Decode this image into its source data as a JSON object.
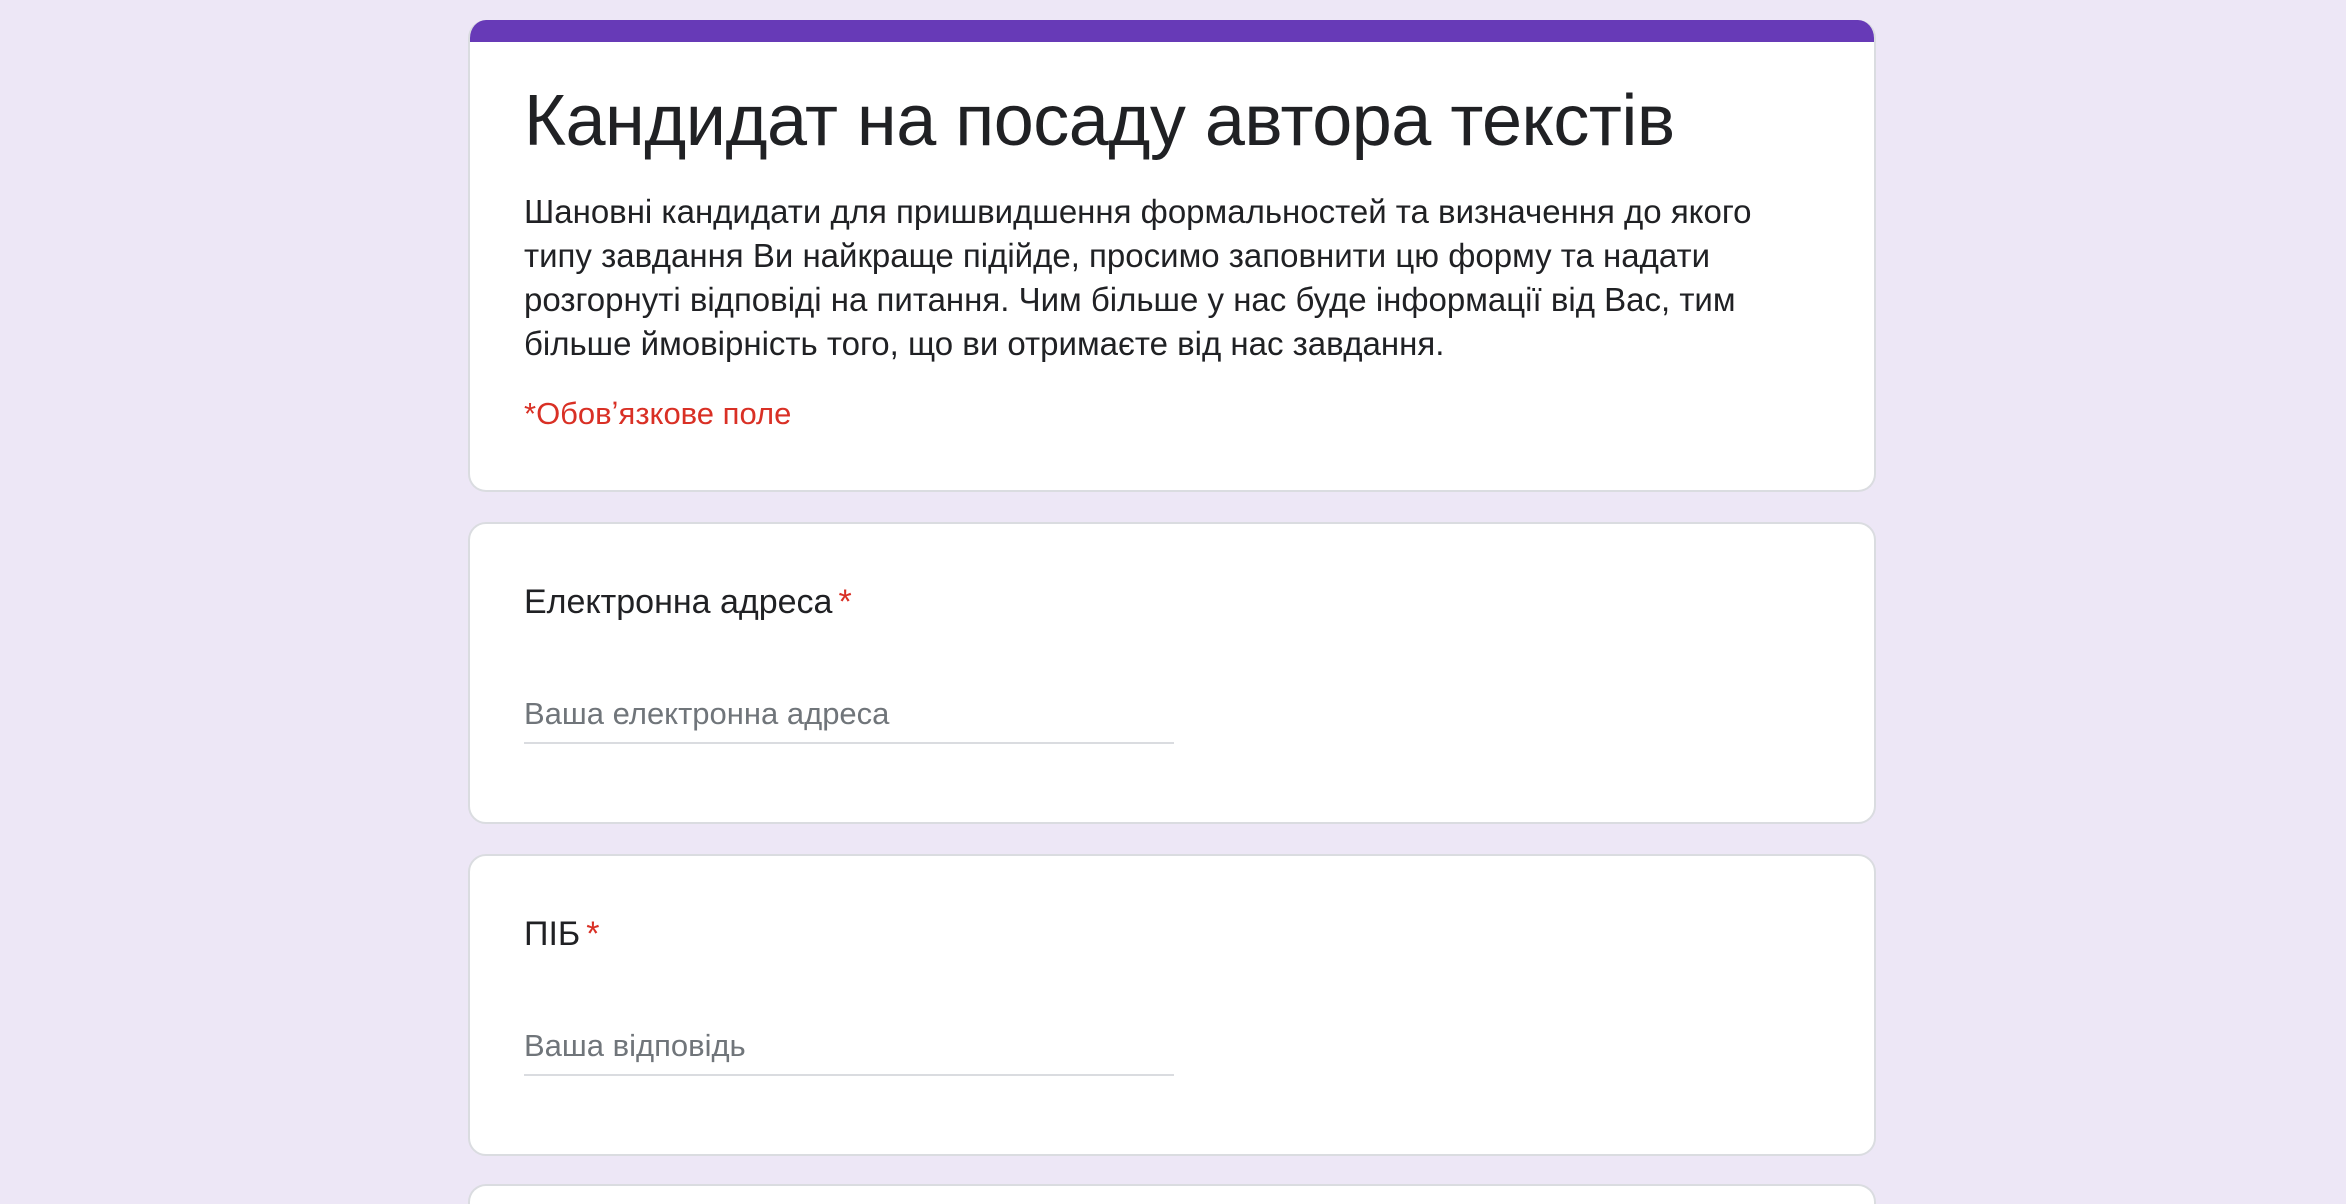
{
  "form": {
    "accent_color": "#673ab7",
    "background_color": "#ede7f6",
    "title": "Кандидат на посаду автора текстів",
    "description": "Шановні кандидати для пришвидшення формальностей та визначення до якого типу завдання Ви найкраще підійде, просимо заповнити цю форму та надати розгорнуті відповіді на питання. Чим більше у нас буде інформації від Вас, тим більше ймовірність того, що ви отримаєте від нас завдання.",
    "required_note": "*Обовʼязкове поле"
  },
  "questions": [
    {
      "title": "Електронна адреса",
      "required_mark": "*",
      "placeholder": "Ваша електронна адреса",
      "value": ""
    },
    {
      "title": "ПІБ",
      "required_mark": "*",
      "placeholder": "Ваша відповідь",
      "value": ""
    }
  ]
}
